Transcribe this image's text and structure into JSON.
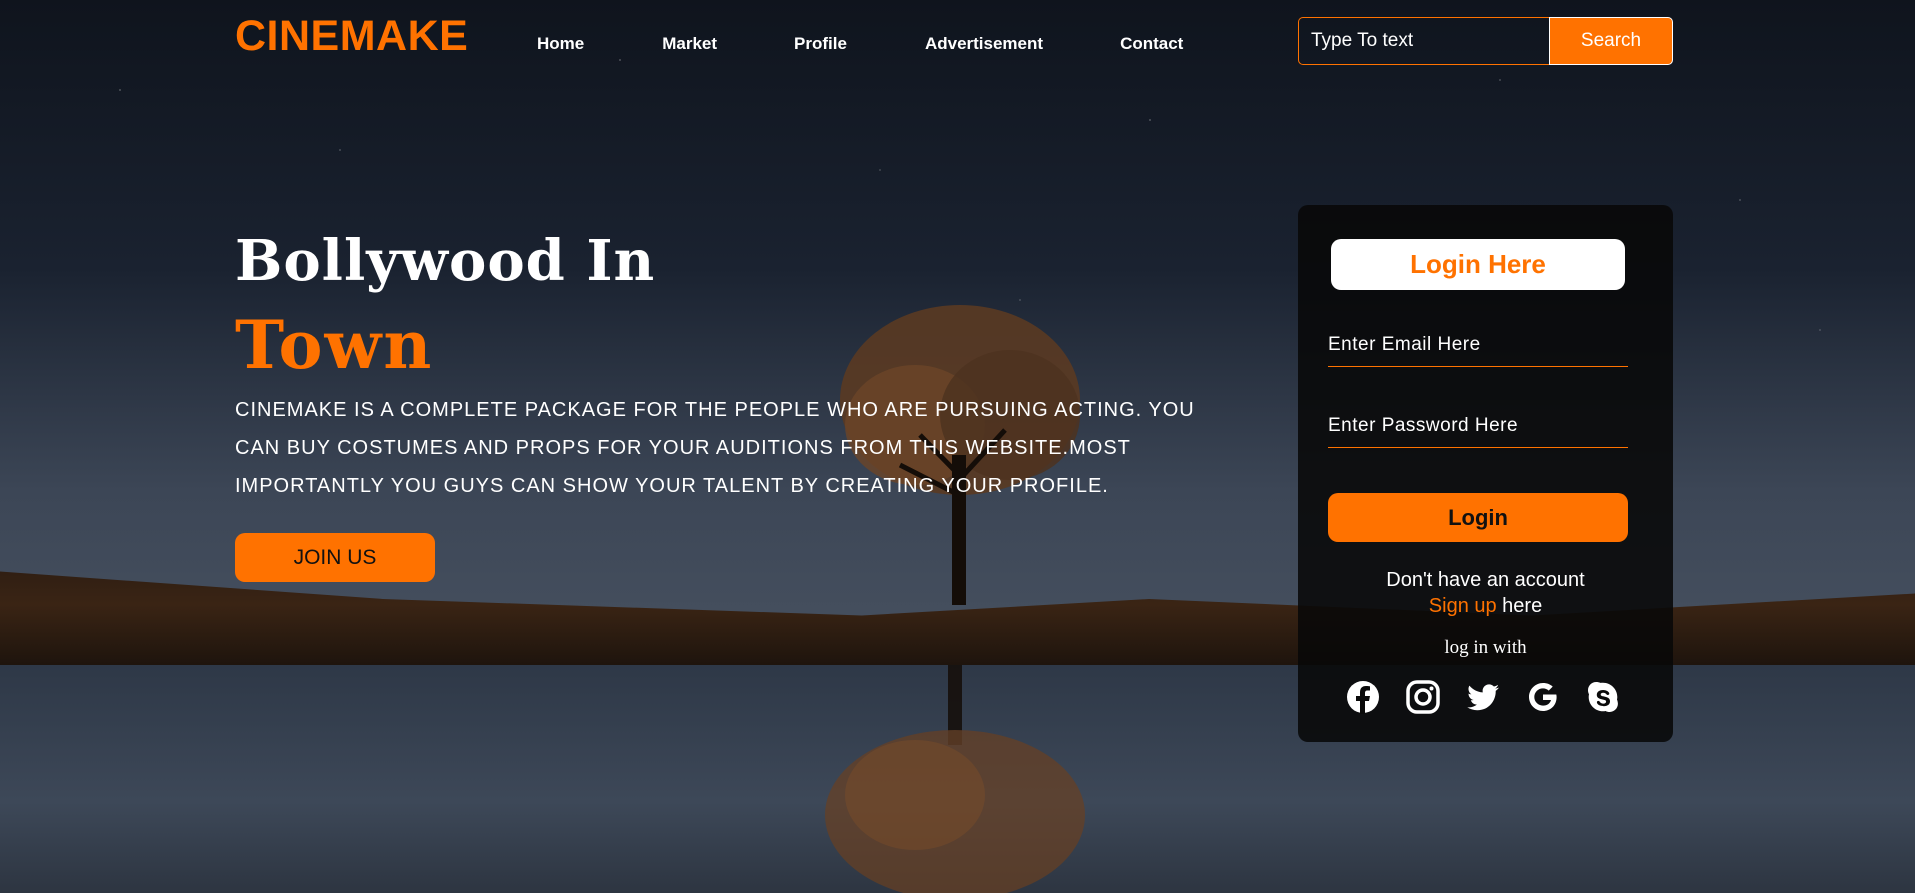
{
  "brand": {
    "logo": "CINEMAKE",
    "accent_color": "#ff7200"
  },
  "nav": {
    "items": [
      "Home",
      "Market",
      "Profile",
      "Advertisement",
      "Contact"
    ]
  },
  "search": {
    "placeholder": "Type To text",
    "button_label": "Search"
  },
  "hero": {
    "title_line1": "Bollywood In",
    "title_line2": "Town",
    "description": "CINEMAKE IS A COMPLETE PACKAGE FOR THE PEOPLE WHO ARE PURSUING ACTING. YOU CAN BUY COSTUMES AND PROPS FOR YOUR AUDITIONS FROM THIS WEBSITE.MOST IMPORTANTLY YOU GUYS CAN SHOW YOUR TALENT BY CREATING YOUR PROFILE.",
    "join_button": "JOIN US"
  },
  "login": {
    "title": "Login Here",
    "email_placeholder": "Enter Email Here",
    "password_placeholder": "Enter Password Here",
    "button_label": "Login",
    "no_account_text": "Don't have an account",
    "signup_link": "Sign up",
    "signup_suffix": " here",
    "login_with": "log in with",
    "social_icons": [
      "facebook-icon",
      "instagram-icon",
      "twitter-icon",
      "google-icon",
      "skype-icon"
    ]
  }
}
